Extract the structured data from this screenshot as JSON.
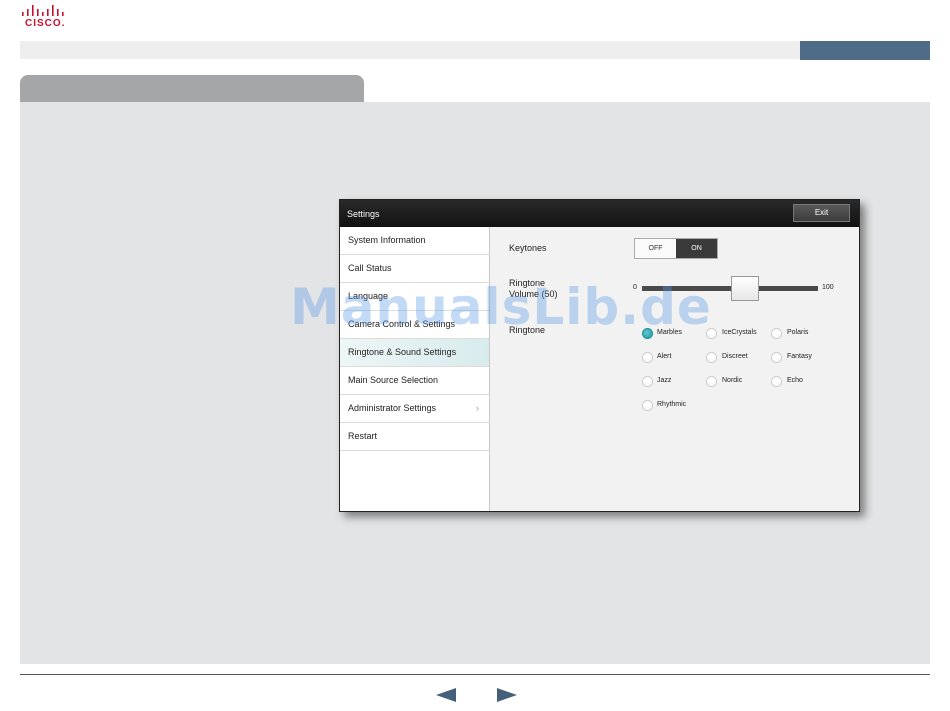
{
  "brand": {
    "logo_text": "CISCO.",
    "logo_color": "#c8102e"
  },
  "window": {
    "title": "Settings",
    "exit_label": "Exit"
  },
  "sidebar": {
    "items": [
      {
        "label": "System Information"
      },
      {
        "label": "Call Status"
      },
      {
        "label": "Language"
      },
      {
        "label": "Camera Control & Settings"
      },
      {
        "label": "Ringtone & Sound Settings",
        "selected": true
      },
      {
        "label": "Main Source Selection"
      },
      {
        "label": "Administrator Settings",
        "has_submenu": true
      },
      {
        "label": "Restart"
      }
    ]
  },
  "settings": {
    "keytones": {
      "label": "Keytones",
      "off_label": "OFF",
      "on_label": "ON",
      "value": "ON"
    },
    "volume": {
      "label_line1": "Ringtone",
      "label_line2": "Volume (50)",
      "min_label": "0",
      "max_label": "100",
      "value": 50
    },
    "ringtone": {
      "label": "Ringtone",
      "options": [
        "Marbles",
        "IceCrystals",
        "Polaris",
        "Alert",
        "Discreet",
        "Fantasy",
        "Jazz",
        "Nordic",
        "Echo",
        "Rhythmic"
      ],
      "selected": "Marbles"
    }
  },
  "watermark": "ManualsLib.de",
  "colors": {
    "accent_bar": "#4f6c86",
    "selected_radio": "#1f97a1",
    "nav_arrow": "#44607a"
  },
  "footer": {
    "prev_icon": "triangle-left-icon",
    "next_icon": "triangle-right-icon"
  }
}
